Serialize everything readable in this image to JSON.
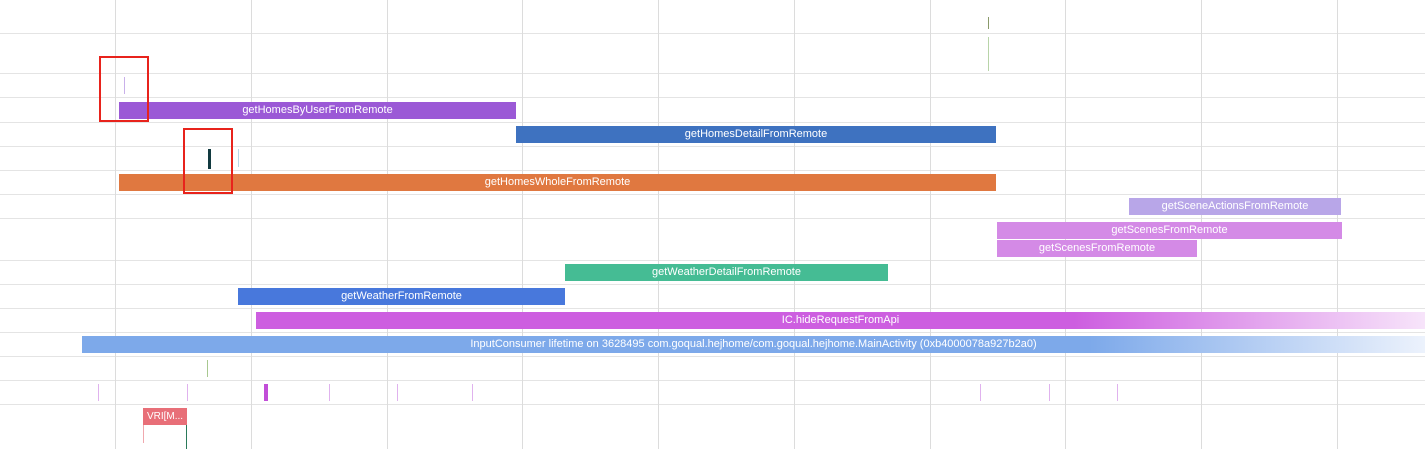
{
  "slices": {
    "homes_by_user": "getHomesByUserFromRemote",
    "homes_detail": "getHomesDetailFromRemote",
    "homes_whole": "getHomesWholeFromRemote",
    "scene_actions": "getSceneActionsFromRemote",
    "scenes_1": "getScenesFromRemote",
    "scenes_2": "getScenesFromRemote",
    "weather_detail": "getWeatherDetailFromRemote",
    "weather": "getWeatherFromRemote",
    "hide_request": "IC.hideRequestFromApi",
    "input_consumer": "InputConsumer lifetime on 3628495 com.goqual.hejhome/com.goqual.hejhome.MainActivity (0xb4000078a927b2a0)",
    "vri": "VRI[M..."
  },
  "colors": {
    "highlight_box": "#e8231c",
    "homes_by_user": "#9b59d6",
    "homes_detail": "#3e72c0",
    "homes_whole": "#e07840",
    "scene_actions": "#b8a6e8",
    "scenes": "#d48ae6",
    "weather_detail": "#45bc94",
    "weather": "#4878dc",
    "hide_request": "#cd5ee0",
    "input_consumer": "#7da9ea",
    "vri": "#e86f78"
  }
}
